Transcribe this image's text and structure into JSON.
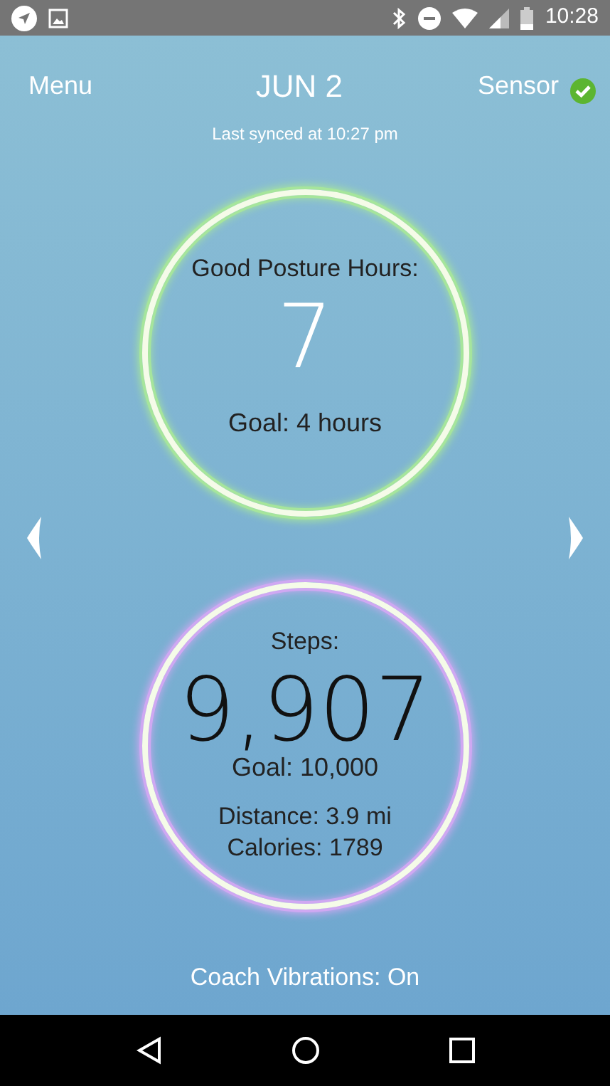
{
  "status_bar": {
    "time": "10:28"
  },
  "header": {
    "menu": "Menu",
    "date": "JUN 2",
    "sensor": {
      "label": "Sensor",
      "connected": true
    },
    "last_synced": "Last synced at 10:27 pm"
  },
  "metrics": [
    {
      "title": "Good Posture Hours:",
      "value": "7",
      "goal": "Goal: 4 hours",
      "color": "#a6e59c"
    },
    {
      "title": "Steps:",
      "value": "9,907",
      "goal": "Goal: 10,000",
      "details": [
        "Distance: 3.9 mi",
        "Calories: 1789"
      ],
      "color": "#cfa8f2"
    }
  ],
  "coach": "Coach Vibrations: On"
}
